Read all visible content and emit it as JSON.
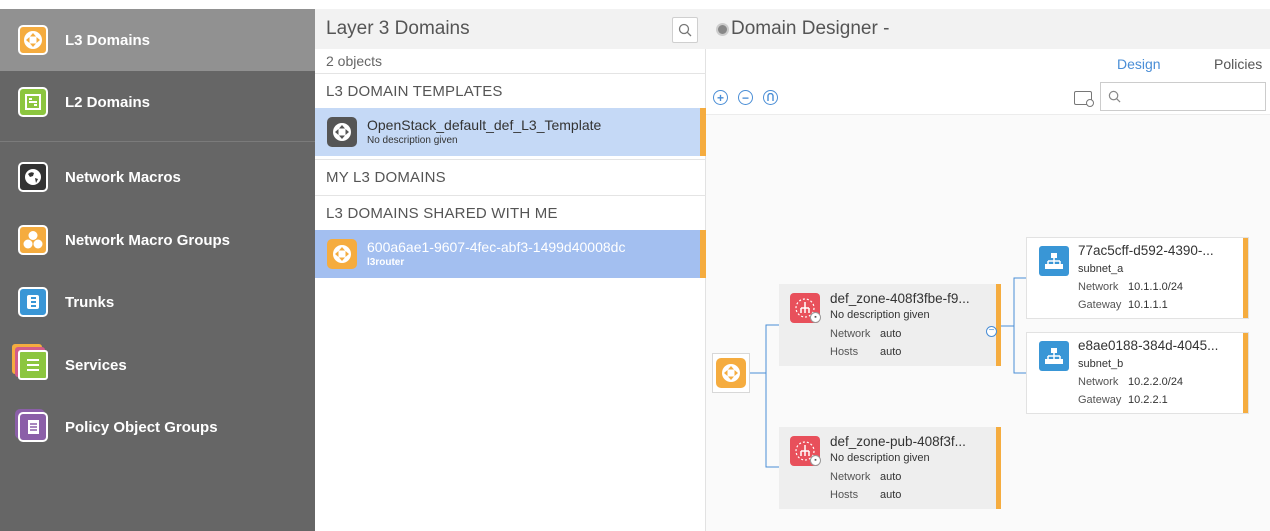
{
  "sidebar": {
    "items": [
      {
        "label": "L3 Domains",
        "icon": "l3-domain-icon",
        "color": "#f5ac3f",
        "active": true
      },
      {
        "label": "L2 Domains",
        "icon": "l2-domain-icon",
        "color": "#8cc63f",
        "active": false
      },
      {
        "label": "Network Macros",
        "icon": "globe-icon",
        "color": "#333333",
        "active": false
      },
      {
        "label": "Network Macro Groups",
        "icon": "macro-group-icon",
        "color": "#f5ac3f",
        "active": false
      },
      {
        "label": "Trunks",
        "icon": "trunk-icon",
        "color": "#3996d6",
        "active": false
      },
      {
        "label": "Services",
        "icon": "services-icon",
        "color": "#8cc63f",
        "active": false
      },
      {
        "label": "Policy Object Groups",
        "icon": "policy-group-icon",
        "color": "#8b5fa8",
        "active": false
      }
    ]
  },
  "list": {
    "title": "Layer 3 Domains",
    "count": "2 objects",
    "sections": {
      "templates": "L3 DOMAIN TEMPLATES",
      "mine": "MY L3 DOMAINS",
      "shared": "L3 DOMAINS SHARED WITH ME"
    },
    "template_item": {
      "name": "OpenStack_default_def_L3_Template",
      "desc": "No description given"
    },
    "shared_item": {
      "name": "600a6ae1-9607-4fec-abf3-1499d40008dc",
      "desc": "l3router"
    }
  },
  "designer": {
    "title": "Domain Designer -",
    "tabs": {
      "design": "Design",
      "policies": "Policies"
    },
    "search_placeholder": "",
    "zones": [
      {
        "name": "def_zone-408f3fbe-f9...",
        "desc": "No description given",
        "network_label": "Network",
        "network": "auto",
        "hosts_label": "Hosts",
        "hosts": "auto"
      },
      {
        "name": "def_zone-pub-408f3f...",
        "desc": "No description given",
        "network_label": "Network",
        "network": "auto",
        "hosts_label": "Hosts",
        "hosts": "auto"
      }
    ],
    "subnets": [
      {
        "name": "77ac5cff-d592-4390-...",
        "sub": "subnet_a",
        "network_label": "Network",
        "network": "10.1.1.0/24",
        "gateway_label": "Gateway",
        "gateway": "10.1.1.1"
      },
      {
        "name": "e8ae0188-384d-4045...",
        "sub": "subnet_b",
        "network_label": "Network",
        "network": "10.2.2.0/24",
        "gateway_label": "Gateway",
        "gateway": "10.2.2.1"
      }
    ]
  },
  "colors": {
    "accent": "#f5ac3f",
    "tab_active": "#4a8ed6",
    "selected_template_bg": "#c5d9f6",
    "selected_shared_bg": "#a3bff0",
    "zone_red": "#e8505b",
    "subnet_blue": "#3996d6"
  }
}
